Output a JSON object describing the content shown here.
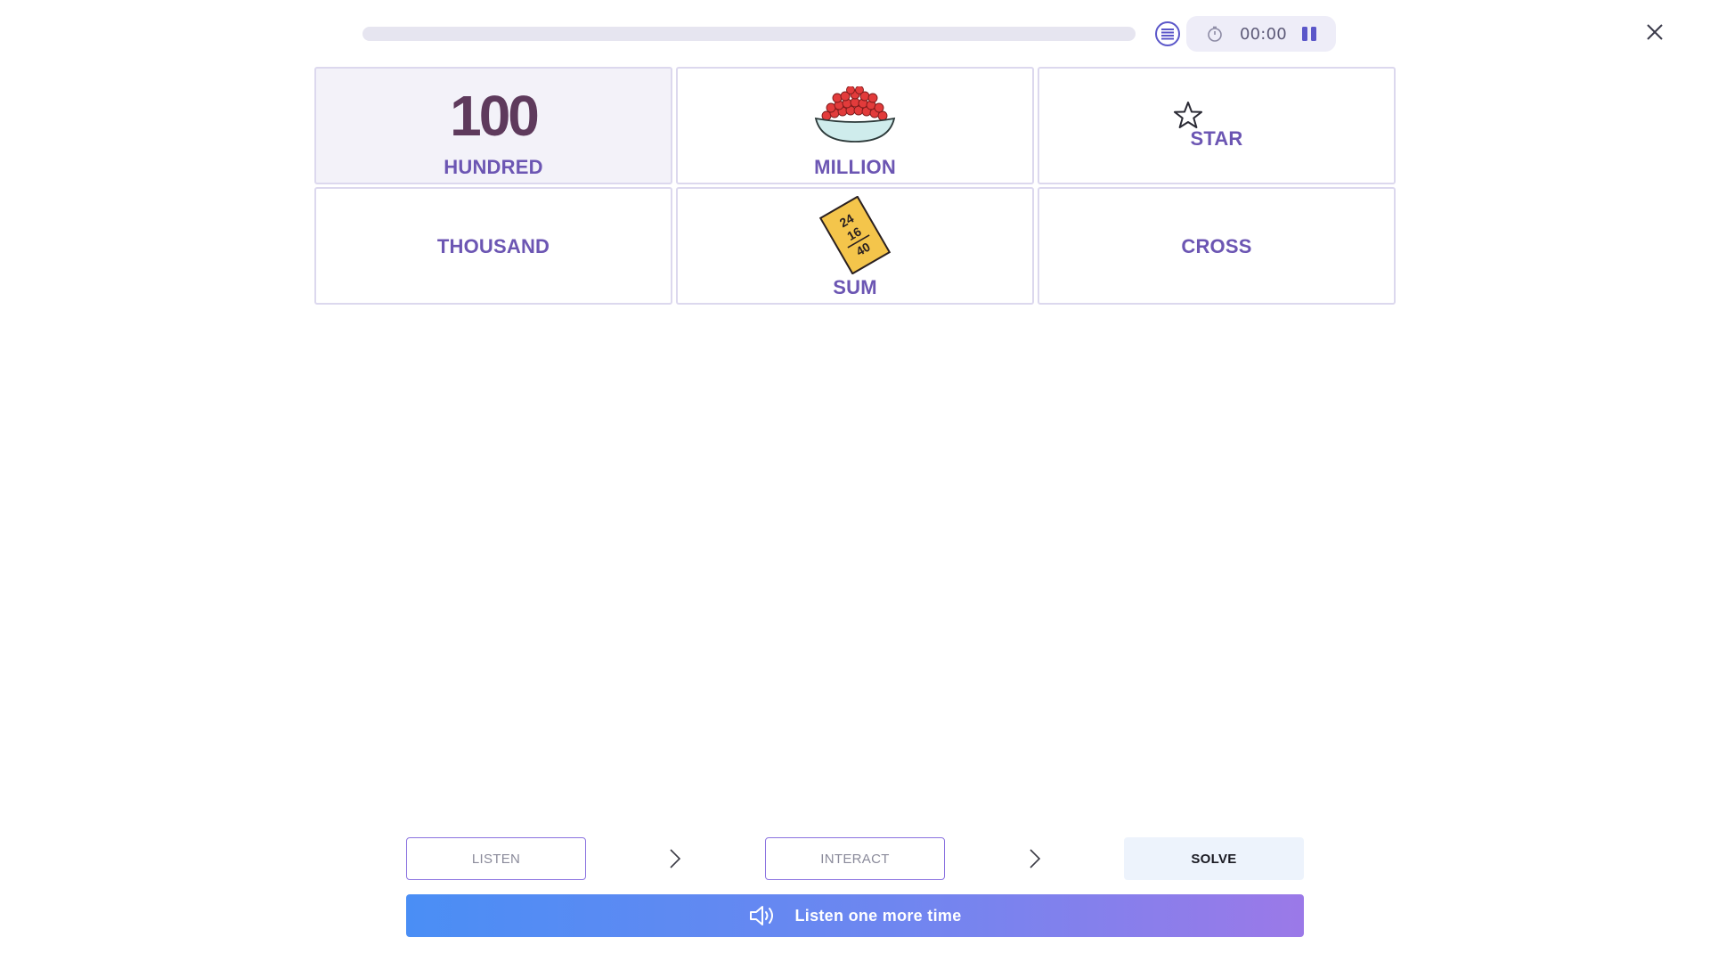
{
  "header": {
    "progress": 0,
    "timer": "00:00",
    "icons": {
      "list": "list-icon",
      "clock": "clock-icon",
      "pause": "pause-icon",
      "close": "close-icon"
    }
  },
  "grid": {
    "cells": [
      {
        "label": "HUNDRED",
        "number": "100",
        "illustration": "number-100",
        "selected": true
      },
      {
        "label": "MILLION",
        "illustration": "bowl-of-berries-icon",
        "selected": false
      },
      {
        "label": "STAR",
        "illustration": "star-icon",
        "selected": false
      },
      {
        "label": "THOUSAND",
        "illustration": "none",
        "selected": false
      },
      {
        "label": "SUM",
        "illustration": "sum-card-icon",
        "card_numbers": [
          "24",
          "16",
          "40"
        ],
        "selected": false
      },
      {
        "label": "CROSS",
        "illustration": "none",
        "selected": false
      }
    ]
  },
  "steps": {
    "listen": "LISTEN",
    "interact": "INTERACT",
    "solve": "SOLVE"
  },
  "listen_again": {
    "label": "Listen one more time",
    "icon": "speaker-icon"
  },
  "colors": {
    "accent": "#5b57c9",
    "label": "#6c56b3",
    "cell_border": "#dcd8ee",
    "selected_cell": "#f3f2f9",
    "gradient_start": "#4a8ef5",
    "gradient_end": "#9b79e8"
  }
}
